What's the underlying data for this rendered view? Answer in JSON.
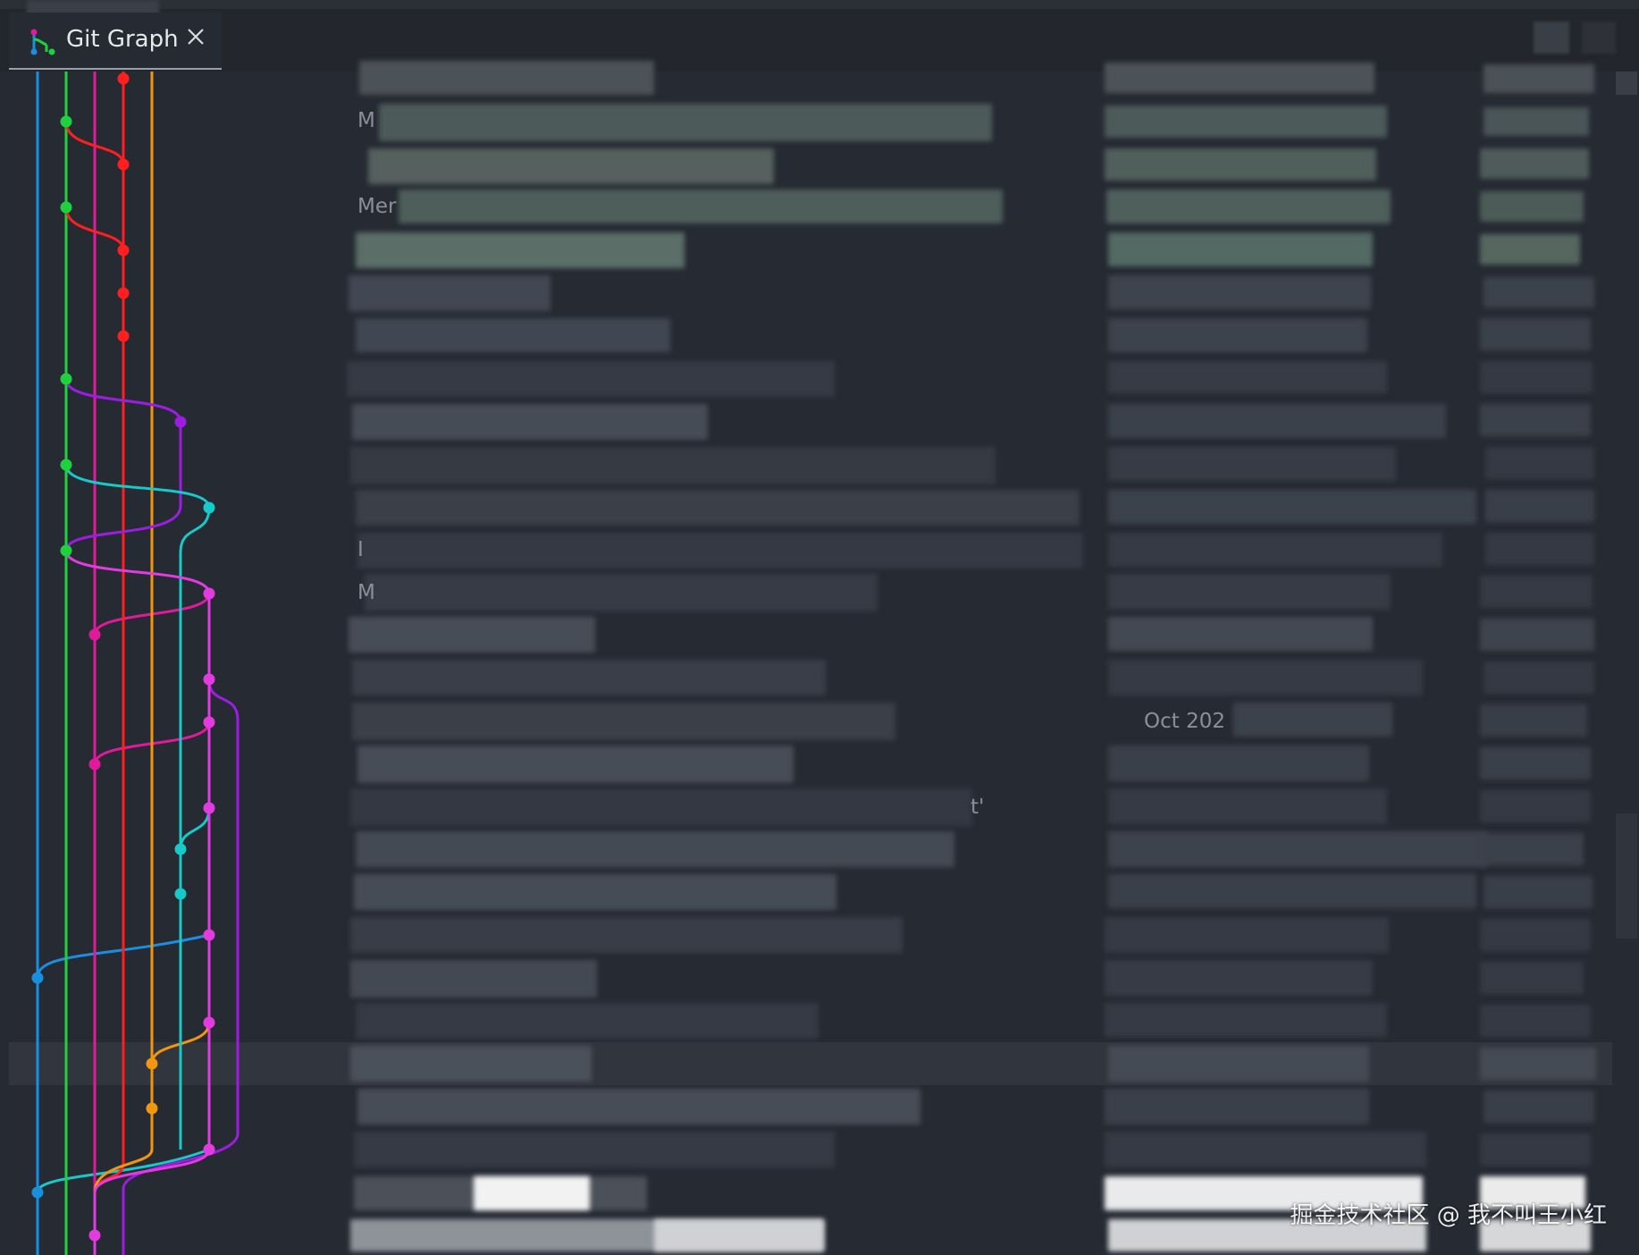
{
  "tab": {
    "title": "Git Graph",
    "close_icon": "close-icon",
    "icon": "git-graph-icon"
  },
  "colors": {
    "background": "#262a33",
    "blue": "#1a8fe0",
    "green": "#1fd13d",
    "magenta": "#e01a9a",
    "red": "#ff1f1f",
    "orange": "#f0960f",
    "purple": "#9b1ee0",
    "cyan": "#17c9c9",
    "pink": "#e33be0"
  },
  "rows": {
    "description_fragments": [
      "M",
      "Mer",
      "",
      "",
      "",
      "",
      "",
      "",
      "",
      "",
      "",
      "I",
      "M"
    ],
    "date_fragment": "Oct 202",
    "quote_fragment": "t'"
  },
  "watermark": "掘金技术社区 @ 我不叫王小红"
}
